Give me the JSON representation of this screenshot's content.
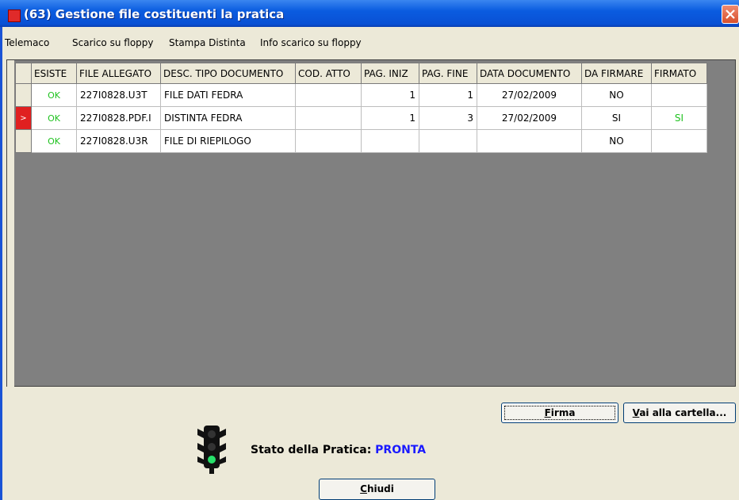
{
  "window": {
    "title": "(63) Gestione file costituenti la pratica"
  },
  "menu": [
    "Telemaco",
    "Scarico su floppy",
    "Stampa Distinta",
    "Info scarico su floppy"
  ],
  "grid": {
    "columns": [
      "ESISTE",
      "FILE ALLEGATO",
      "DESC. TIPO DOCUMENTO",
      "COD. ATTO",
      "PAG. INIZ",
      "PAG. FINE",
      "DATA DOCUMENTO",
      "DA FIRMARE",
      "FIRMATO"
    ],
    "rows": [
      {
        "indicator": "",
        "esiste": "OK",
        "file": "227I0828.U3T",
        "desc": "FILE DATI FEDRA",
        "cod": "",
        "pag_iniz": "1",
        "pag_fine": "1",
        "data": "27/02/2009",
        "da_firmare": "NO",
        "firmato": ""
      },
      {
        "indicator": ">",
        "esiste": "OK",
        "file": "227I0828.PDF.I",
        "desc": "DISTINTA FEDRA",
        "cod": "",
        "pag_iniz": "1",
        "pag_fine": "3",
        "data": "27/02/2009",
        "da_firmare": "SI",
        "firmato": "SI"
      },
      {
        "indicator": "",
        "esiste": "OK",
        "file": "227I0828.U3R",
        "desc": "FILE DI RIEPILOGO",
        "cod": "",
        "pag_iniz": "",
        "pag_fine": "",
        "data": "",
        "da_firmare": "NO",
        "firmato": ""
      }
    ],
    "selected_row": 1
  },
  "buttons": {
    "firma_first": "F",
    "firma_rest": "irma",
    "vai_first": "V",
    "vai_rest": "ai alla cartella...",
    "chiudi_first": "C",
    "chiudi_rest": "hiudi"
  },
  "status": {
    "label": "Stato della Pratica:",
    "value": "PRONTA",
    "light": "green"
  },
  "colors": {
    "titlebar": "#0a5ce0",
    "ok_green": "#1ec21e",
    "status_blue": "#1a1aff",
    "indicator_red": "#e02020"
  }
}
